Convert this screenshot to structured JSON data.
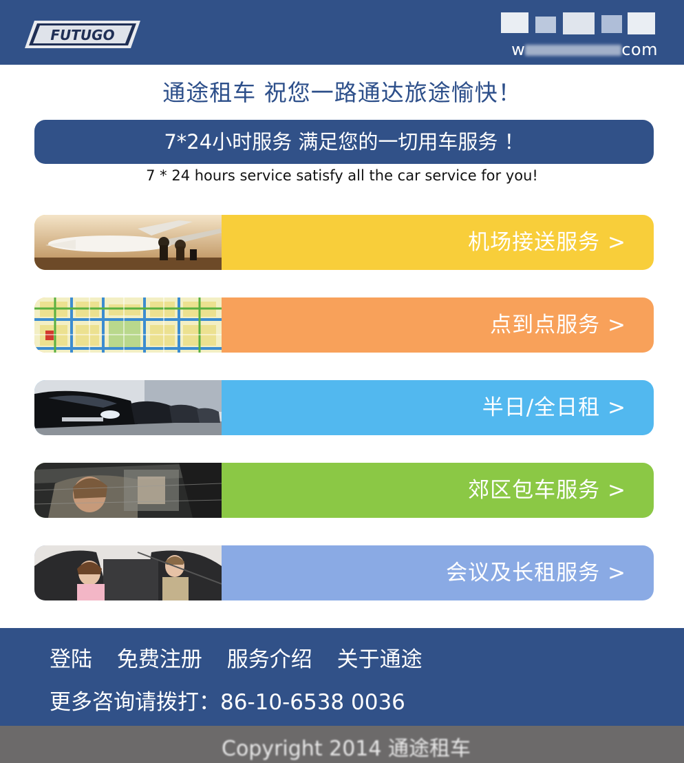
{
  "header": {
    "logo_text": "FUTUGO",
    "url_suffix": "com"
  },
  "slogan": "通途租车 祝您一路通达旅途愉快！",
  "banner": {
    "title": "7*24小时服务 满足您的一切用车服务 ！",
    "subtitle": "7 * 24 hours service satisfy all the car service for you!"
  },
  "services": [
    {
      "label": "机场接送服务 >",
      "color": "#f8ce3a"
    },
    {
      "label": "点到点服务 >",
      "color": "#f8a15a"
    },
    {
      "label": "半日/全日租 >",
      "color": "#52b8ef"
    },
    {
      "label": "郊区包车服务 >",
      "color": "#8bc845"
    },
    {
      "label": "会议及长租服务 >",
      "color": "#8aaae4"
    }
  ],
  "footer": {
    "links": [
      "登陆",
      "免费注册",
      "服务介绍",
      "关于通途"
    ],
    "phone": "更多咨询请拨打：86-10-6538 0036"
  },
  "copyright": "Copyright 2014 通途租车"
}
